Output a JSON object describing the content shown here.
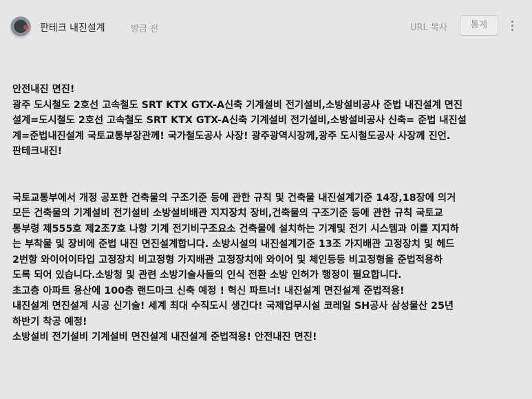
{
  "header": {
    "author": "판테크 내진설계",
    "time": "방금 전",
    "url_copy": "URL 복사",
    "stats": "통계",
    "more_icon": "more-vertical-icon"
  },
  "body": {
    "paragraph1": [
      "안전내진 면진!",
      "광주 도시철도 2호선 고속철도 SRT KTX GTX-A신축 기계설비 전기설비,소방설비공사 준법 내진설계 면진",
      "설계=도시철도 2호선 고속철도 SRT KTX GTX-A신축 기계설비 전기설비,소방설비공사 신축= 준법 내진설",
      "계=준법내진설계 국토교통부장관께! 국가철도공사 사장! 광주광역시장께,광주 도시철도공사 사장께 진언.",
      "판테크내진!"
    ],
    "paragraph2": [
      "국토교통부에서 개정 공포한 건축물의 구조기준 등에 관한 규칙 및 건축물 내진설계기준 14장,18장에 의거",
      "모든 건축물의 기계설비 전기설비 소방설비배관 지지장치 장비,건축물의 구조기준 등에 관한 규칙 국토교",
      "통부령 제555호 제2조7호 나항 기계 전기비구조요소 건축물에 설치하는 기계및 전기 시스템과 이를 지지하",
      "는 부착물 및 장비에 준법 내진 면진설계합니다. 소방시설의 내진설계기준 13조 가지배관 고정장치 및 헤드",
      "2번항 와이어이타입 고정장치 비고정형 가지배관 고정장치에 와이어 및 체인등등 비고정형을 준법적용하",
      "도록 되어 있습니다.소방청 및 관련 소방기술사들의 인식 전환 소방 인허가 행정이 필요합니다.",
      "초고층 아파트 용산에 100층 랜드마크 신축 예정 ! 혁신 파트너! 내진설계 면진설계 준법적용!",
      "내진설계 면진설계 시공 신기술! 세계 최대 수직도시 생긴다! 국제업무시설 코레일 SH공사 삼성물산 25년",
      "하반기 착공 예정!",
      "소방설비 전기설비 기계설비 면진설계 내진설계 준법적용! 안전내진 면진!"
    ]
  }
}
